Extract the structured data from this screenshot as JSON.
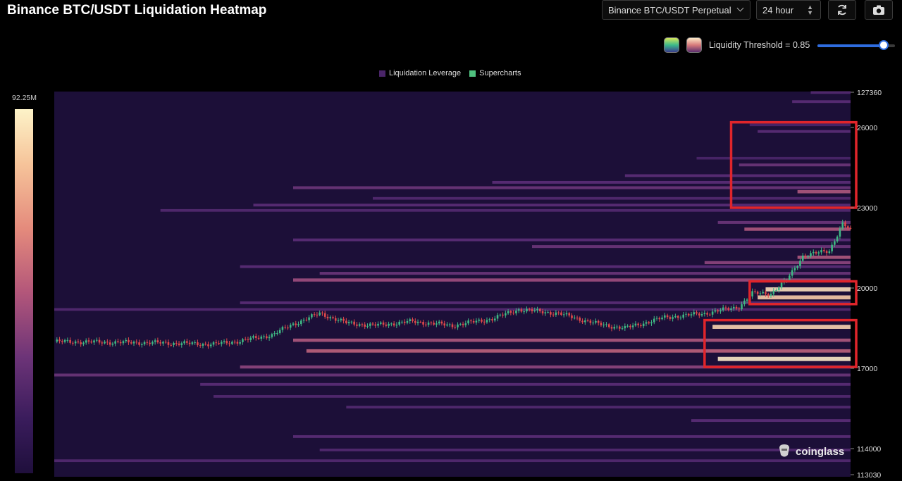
{
  "header": {
    "title": "Binance BTC/USDT Liquidation Heatmap",
    "exchange_select": "Binance BTC/USDT Perpetual",
    "range_select": "24 hour"
  },
  "threshold": {
    "label": "Liquidity Threshold = 0.85",
    "value": 0.85
  },
  "legend": [
    {
      "name": "Liquidation Leverage",
      "color": "#4a2569"
    },
    {
      "name": "Supercharts",
      "color": "#4fc17f"
    }
  ],
  "colorbar": {
    "max_label": "92.25M"
  },
  "watermark": "coinglass",
  "colors": {
    "background": "#1c0f38",
    "up_candle": "#3fb884",
    "down_candle": "#e0494b",
    "highlight_box": "#e0252b",
    "accent": "#2f6de0"
  },
  "chart_data": {
    "type": "heatmap",
    "title": "Binance BTC/USDT Liquidation Heatmap",
    "ylim": [
      113030,
      127360
    ],
    "y_ticks": [
      "127360",
      "26000",
      "23000",
      "20000",
      "17000",
      "114000",
      "113030"
    ],
    "y_tick_values": [
      127360,
      126000,
      123000,
      120000,
      117000,
      114000,
      113030
    ],
    "x": {
      "unit": "candle index",
      "range": [
        0,
        300
      ]
    },
    "price_series": [
      {
        "x": 0,
        "y": 118000
      },
      {
        "x": 40,
        "y": 117950
      },
      {
        "x": 60,
        "y": 117900
      },
      {
        "x": 70,
        "y": 118020
      },
      {
        "x": 82,
        "y": 118250
      },
      {
        "x": 90,
        "y": 118650
      },
      {
        "x": 100,
        "y": 119050
      },
      {
        "x": 110,
        "y": 118700
      },
      {
        "x": 120,
        "y": 118600
      },
      {
        "x": 135,
        "y": 118750
      },
      {
        "x": 150,
        "y": 118600
      },
      {
        "x": 165,
        "y": 118850
      },
      {
        "x": 175,
        "y": 119200
      },
      {
        "x": 190,
        "y": 119050
      },
      {
        "x": 205,
        "y": 118650
      },
      {
        "x": 215,
        "y": 118500
      },
      {
        "x": 230,
        "y": 118900
      },
      {
        "x": 245,
        "y": 119050
      },
      {
        "x": 258,
        "y": 119300
      },
      {
        "x": 263,
        "y": 119800
      },
      {
        "x": 270,
        "y": 119800
      },
      {
        "x": 276,
        "y": 120300
      },
      {
        "x": 282,
        "y": 121200
      },
      {
        "x": 292,
        "y": 121400
      },
      {
        "x": 295,
        "y": 122000
      },
      {
        "x": 297,
        "y": 122400
      },
      {
        "x": 300,
        "y": 122150
      }
    ],
    "bands": [
      {
        "y": 127350,
        "x_start": 285,
        "intensity": 0.25
      },
      {
        "y": 127000,
        "x_start": 278,
        "intensity": 0.3
      },
      {
        "y": 126100,
        "x_start": 262,
        "intensity": 0.2
      },
      {
        "y": 125850,
        "x_start": 265,
        "intensity": 0.3
      },
      {
        "y": 124850,
        "x_start": 242,
        "intensity": 0.2
      },
      {
        "y": 124600,
        "x_start": 258,
        "intensity": 0.35
      },
      {
        "y": 124200,
        "x_start": 215,
        "intensity": 0.3
      },
      {
        "y": 123950,
        "x_start": 165,
        "intensity": 0.3
      },
      {
        "y": 123750,
        "x_start": 90,
        "intensity": 0.35
      },
      {
        "y": 123600,
        "x_start": 280,
        "intensity": 0.55
      },
      {
        "y": 123350,
        "x_start": 120,
        "intensity": 0.25
      },
      {
        "y": 123100,
        "x_start": 75,
        "intensity": 0.3
      },
      {
        "y": 122900,
        "x_start": 40,
        "intensity": 0.25
      },
      {
        "y": 122450,
        "x_start": 250,
        "intensity": 0.35
      },
      {
        "y": 122200,
        "x_start": 260,
        "intensity": 0.55
      },
      {
        "y": 121800,
        "x_start": 90,
        "intensity": 0.3
      },
      {
        "y": 121550,
        "x_start": 180,
        "intensity": 0.35
      },
      {
        "y": 121150,
        "x_start": 280,
        "intensity": 0.55
      },
      {
        "y": 120950,
        "x_start": 245,
        "intensity": 0.45
      },
      {
        "y": 120800,
        "x_start": 70,
        "intensity": 0.3
      },
      {
        "y": 120550,
        "x_start": 100,
        "intensity": 0.35
      },
      {
        "y": 120300,
        "x_start": 90,
        "intensity": 0.5
      },
      {
        "y": 119950,
        "x_start": 268,
        "intensity": 0.95
      },
      {
        "y": 119650,
        "x_start": 265,
        "intensity": 0.9
      },
      {
        "y": 119450,
        "x_start": 70,
        "intensity": 0.3
      },
      {
        "y": 119200,
        "x_start": 0,
        "intensity": 0.25
      },
      {
        "y": 118550,
        "x_start": 248,
        "intensity": 0.92
      },
      {
        "y": 118050,
        "x_start": 90,
        "intensity": 0.55
      },
      {
        "y": 117650,
        "x_start": 95,
        "intensity": 0.6
      },
      {
        "y": 117350,
        "x_start": 250,
        "intensity": 0.98
      },
      {
        "y": 117050,
        "x_start": 70,
        "intensity": 0.45
      },
      {
        "y": 116750,
        "x_start": 0,
        "intensity": 0.35
      },
      {
        "y": 116400,
        "x_start": 55,
        "intensity": 0.3
      },
      {
        "y": 115950,
        "x_start": 60,
        "intensity": 0.25
      },
      {
        "y": 115550,
        "x_start": 110,
        "intensity": 0.25
      },
      {
        "y": 115050,
        "x_start": 240,
        "intensity": 0.3
      },
      {
        "y": 114450,
        "x_start": 90,
        "intensity": 0.3
      },
      {
        "y": 113950,
        "x_start": 100,
        "intensity": 0.25
      },
      {
        "y": 113550,
        "x_start": 0,
        "intensity": 0.25
      }
    ],
    "highlights": [
      {
        "x_range": [
          255,
          300
        ],
        "y_range": [
          123000,
          126200
        ]
      },
      {
        "x_range": [
          262,
          300
        ],
        "y_range": [
          119400,
          120250
        ]
      },
      {
        "x_range": [
          245,
          300
        ],
        "y_range": [
          117050,
          118800
        ]
      }
    ]
  }
}
